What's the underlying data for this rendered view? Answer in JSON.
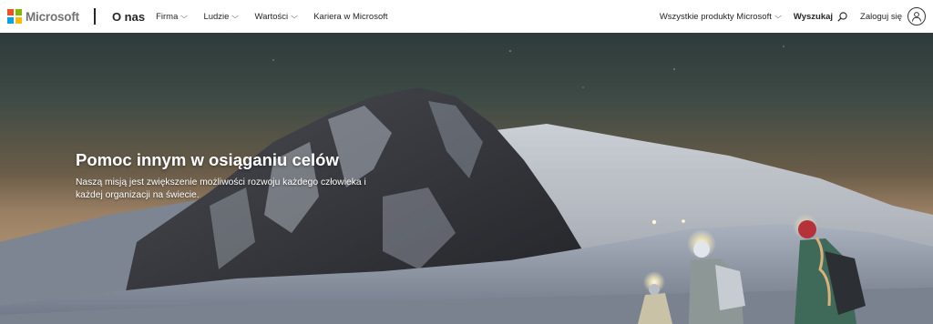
{
  "brand": {
    "name": "Microsoft",
    "logo_colors": [
      "#f25022",
      "#7fba00",
      "#00a4ef",
      "#ffb900"
    ]
  },
  "header": {
    "site_title": "O nas",
    "nav": [
      {
        "label": "Firma",
        "has_dropdown": true
      },
      {
        "label": "Ludzie",
        "has_dropdown": true
      },
      {
        "label": "Wartości",
        "has_dropdown": true
      },
      {
        "label": "Kariera w Microsoft",
        "has_dropdown": false
      }
    ],
    "all_products": "Wszystkie produkty Microsoft",
    "search_label": "Wyszukaj",
    "signin_label": "Zaloguj się",
    "icons": {
      "dropdown": "chevron-down-icon",
      "search": "search-icon",
      "account": "account-icon"
    }
  },
  "hero": {
    "title": "Pomoc innym w osiąganiu celów",
    "subtitle": "Naszą misją jest zwiększenie możliwości rozwoju każdego człowieka i każdej organizacji na świecie.",
    "image": "mountain-climbers-night-image"
  }
}
